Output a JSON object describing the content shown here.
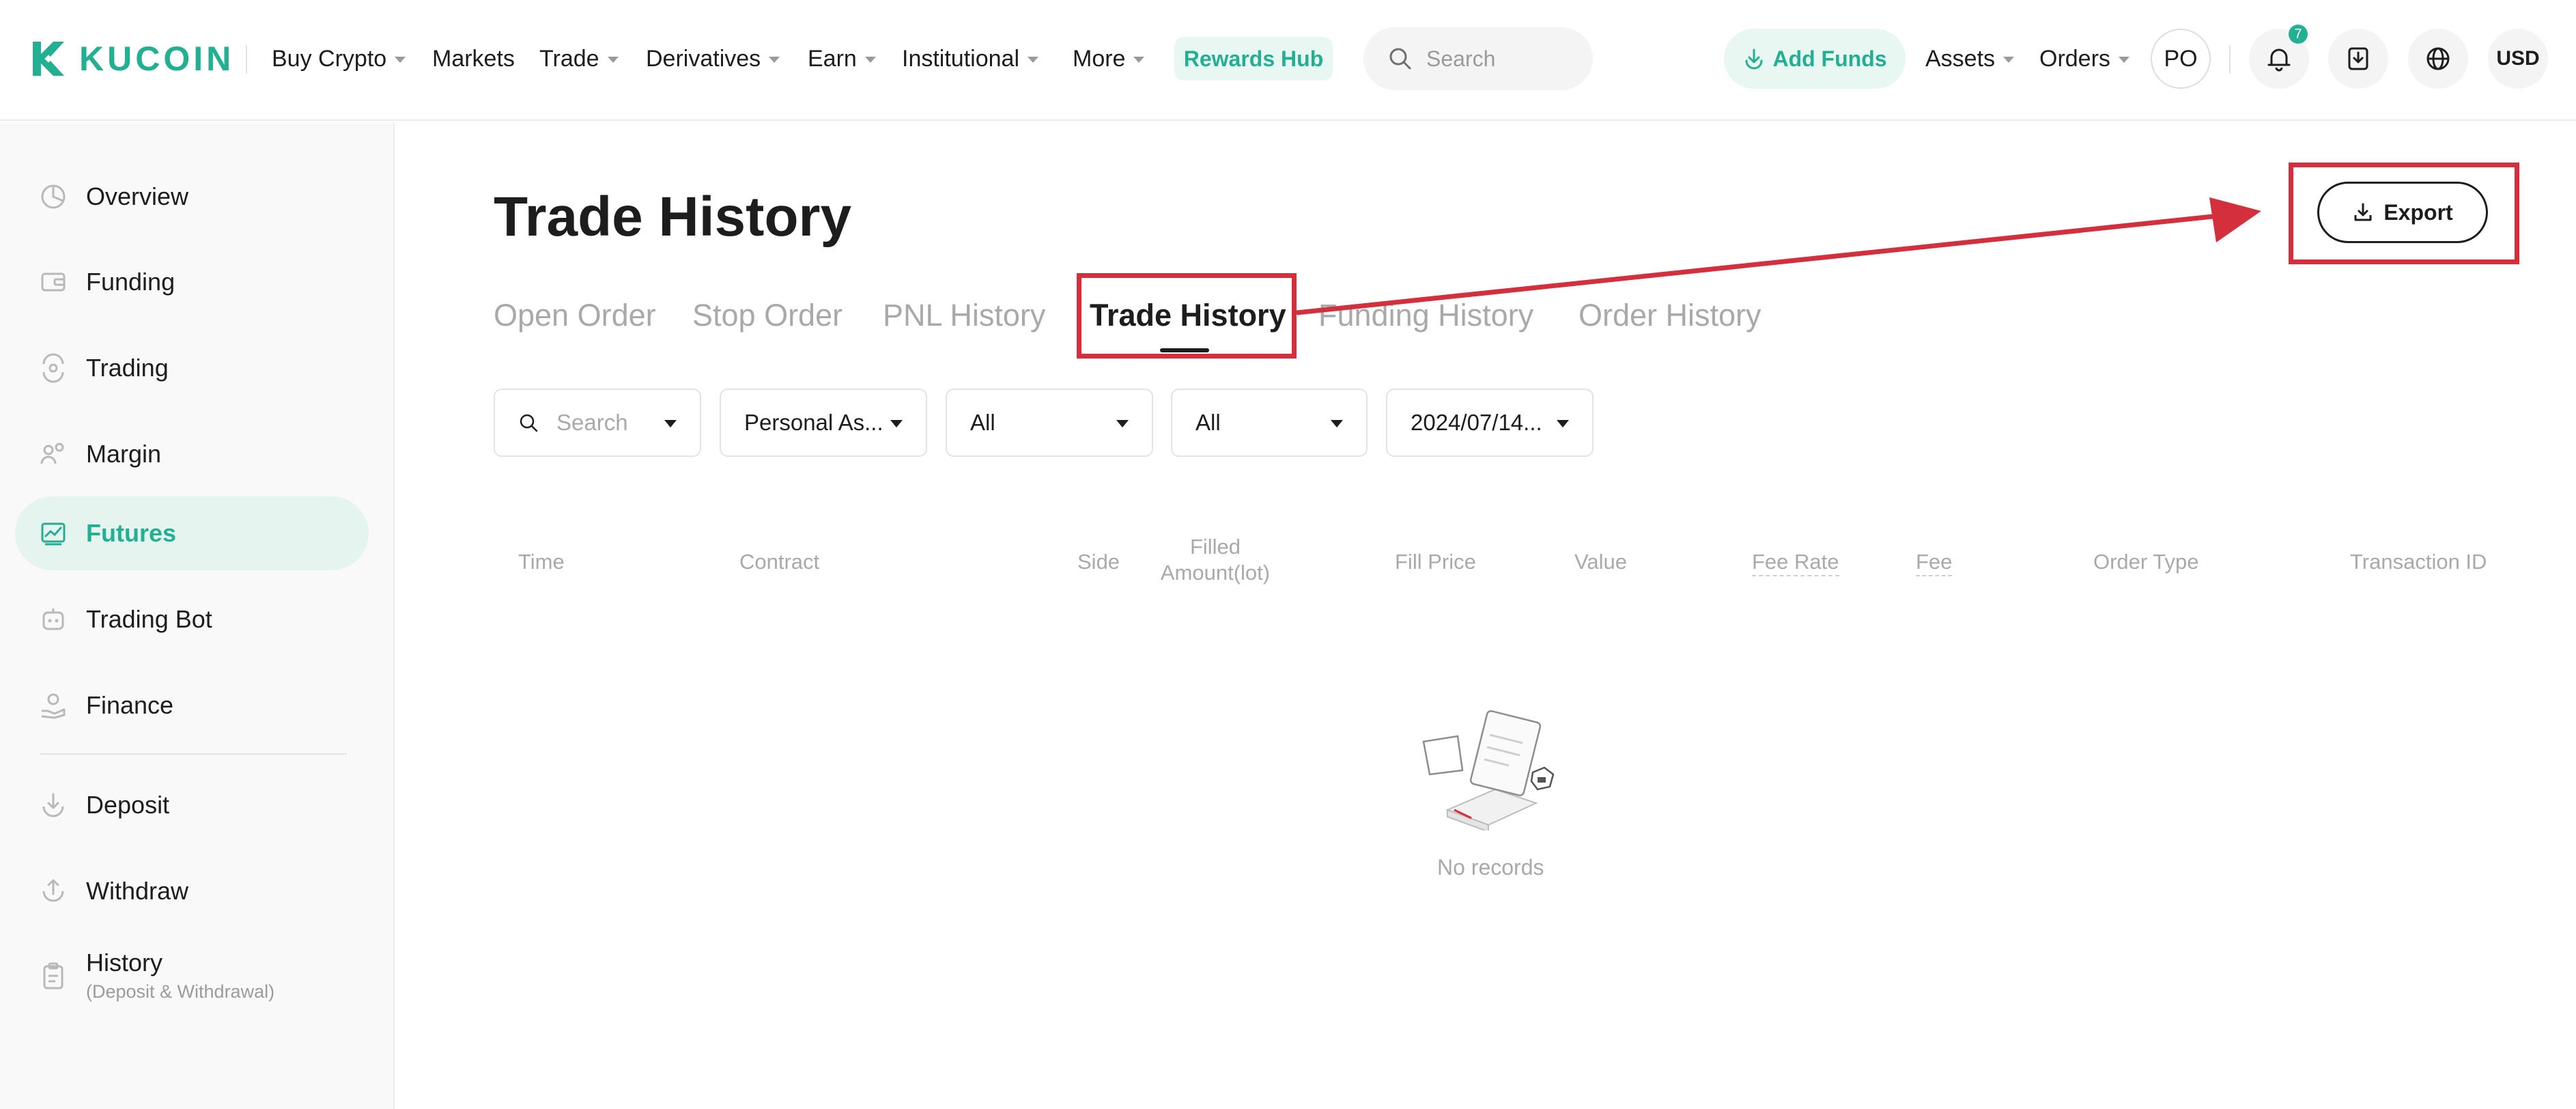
{
  "header": {
    "logo_text": "KUCOIN",
    "nav": [
      {
        "label": "Buy Crypto",
        "dropdown": true
      },
      {
        "label": "Markets",
        "dropdown": false
      },
      {
        "label": "Trade",
        "dropdown": true
      },
      {
        "label": "Derivatives",
        "dropdown": true
      },
      {
        "label": "Earn",
        "dropdown": true
      },
      {
        "label": "Institutional",
        "dropdown": true
      },
      {
        "label": "More",
        "dropdown": true
      }
    ],
    "rewards_label": "Rewards Hub",
    "search_placeholder": "Search",
    "add_funds_label": "Add Funds",
    "assets_label": "Assets",
    "orders_label": "Orders",
    "avatar_initials": "PO",
    "notification_count": "7",
    "currency_label": "USD"
  },
  "sidebar": {
    "items": [
      {
        "label": "Overview",
        "icon": "pie-chart-icon"
      },
      {
        "label": "Funding",
        "icon": "wallet-icon"
      },
      {
        "label": "Trading",
        "icon": "exchange-icon"
      },
      {
        "label": "Margin",
        "icon": "users-icon"
      },
      {
        "label": "Futures",
        "icon": "futures-chart-icon",
        "active": true
      },
      {
        "label": "Trading Bot",
        "icon": "robot-icon"
      },
      {
        "label": "Finance",
        "icon": "hand-coin-icon"
      },
      {
        "label": "Deposit",
        "icon": "deposit-icon"
      },
      {
        "label": "Withdraw",
        "icon": "withdraw-icon"
      },
      {
        "label": "History",
        "sublabel": "(Deposit & Withdrawal)",
        "icon": "clipboard-icon"
      }
    ]
  },
  "main": {
    "title": "Trade History",
    "export_label": "Export",
    "tabs": [
      {
        "label": "Open Order"
      },
      {
        "label": "Stop Order"
      },
      {
        "label": "PNL History"
      },
      {
        "label": "Trade History",
        "active": true
      },
      {
        "label": "Funding History"
      },
      {
        "label": "Order History"
      }
    ],
    "filters": {
      "search_placeholder": "Search",
      "account": "Personal As...",
      "side": "All",
      "type": "All",
      "date": "2024/07/14..."
    },
    "table": {
      "columns": [
        "Time",
        "Contract",
        "Side",
        "Filled Amount(lot)",
        "Fill Price",
        "Value",
        "Fee Rate",
        "Fee",
        "Order Type",
        "Transaction ID"
      ],
      "empty_text": "No records"
    }
  },
  "colors": {
    "brand": "#23af91",
    "highlight": "#d32f3d",
    "active_bg": "#e6f4ef"
  }
}
